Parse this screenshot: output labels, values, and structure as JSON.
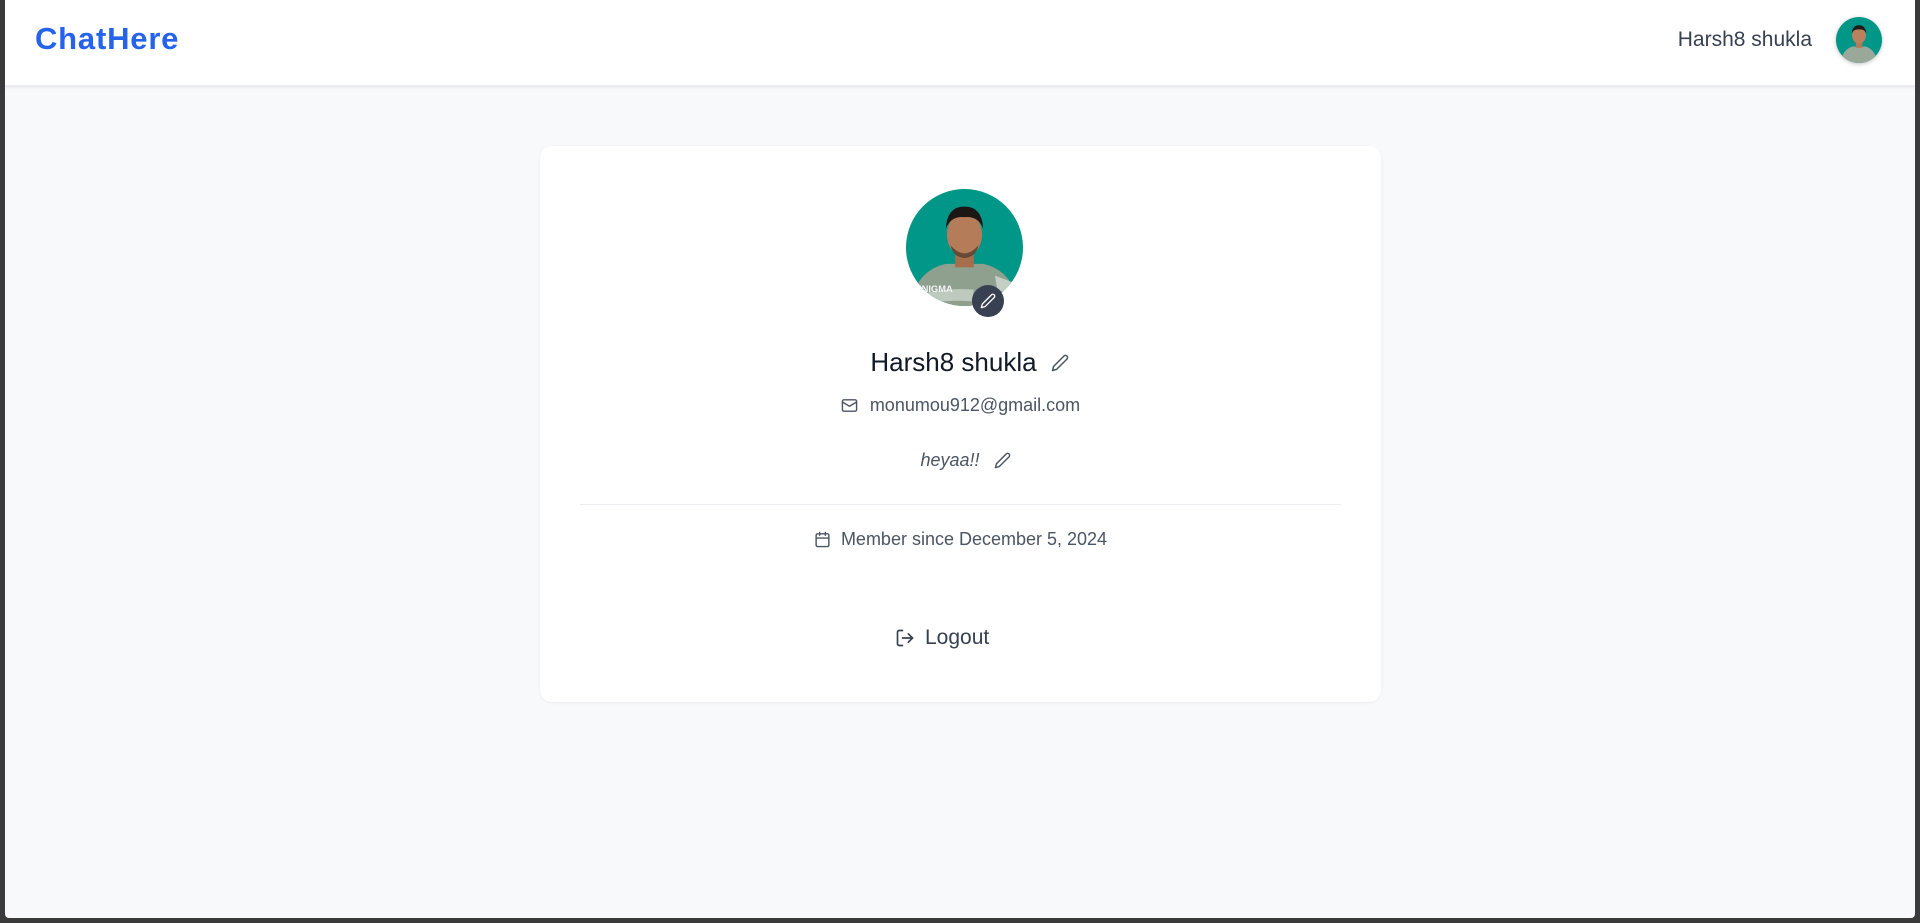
{
  "navbar": {
    "brand": "ChatHere",
    "user_name": "Harsh8 shukla",
    "avatar_icon": "user-avatar-photo"
  },
  "profile": {
    "name": "Harsh8 shukla",
    "email": "monumou912@gmail.com",
    "bio": "heyaa!!",
    "member_since": "Member since December 5, 2024",
    "avatar_shirt_text": "ENIGMA",
    "logout_label": "Logout"
  },
  "icons": {
    "edit_avatar": "pencil-icon",
    "edit_name": "pencil-icon",
    "edit_bio": "pencil-icon",
    "email": "mail-icon",
    "calendar": "calendar-icon",
    "logout": "log-out-icon"
  },
  "colors": {
    "brand": "#2563eb",
    "avatar_bg": "#009688",
    "page_bg": "#f8f9fb",
    "card_bg": "#ffffff",
    "text_primary": "#111827",
    "text_secondary": "#4b5563"
  }
}
